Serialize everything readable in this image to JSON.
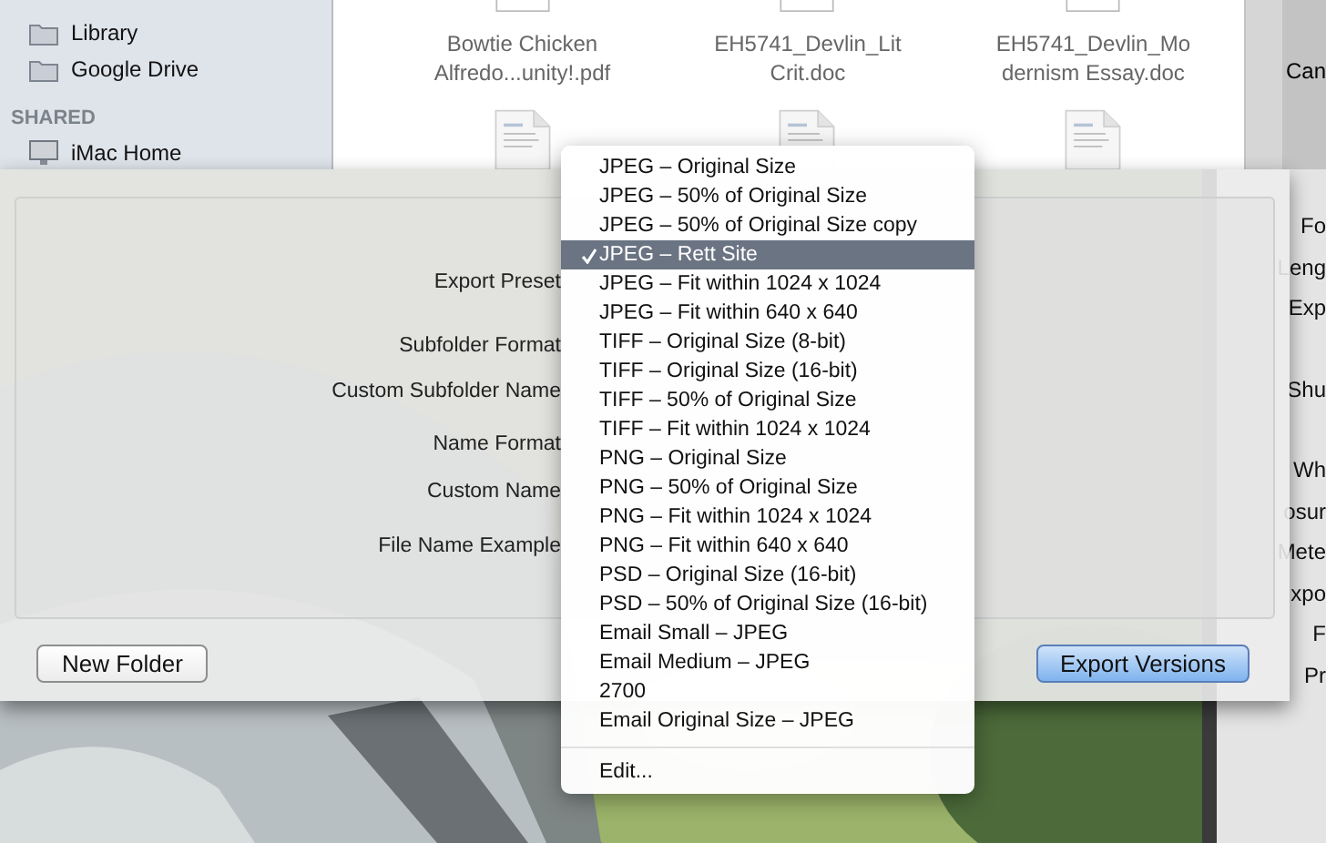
{
  "sidebar": {
    "items": [
      {
        "label": "Library",
        "kind": "folder"
      },
      {
        "label": "Google Drive",
        "kind": "folder"
      }
    ],
    "sections": [
      {
        "heading": "SHARED",
        "items": [
          {
            "label": "iMac Home",
            "kind": "computer"
          }
        ]
      }
    ]
  },
  "files": [
    {
      "name_lines": [
        "Bowtie Chicken",
        "Alfredo...unity!.pdf"
      ]
    },
    {
      "name_lines": [
        "EH5741_Devlin_Lit",
        "Crit.doc"
      ]
    },
    {
      "name_lines": [
        "EH5741_Devlin_Mo",
        "dernism Essay.doc"
      ]
    }
  ],
  "top_right_label": "Can",
  "right_panel": {
    "labels": [
      "Fo",
      "Leng",
      "Exp",
      "Shu",
      "Wh",
      "osur",
      "Mete",
      "xpo",
      "F",
      "Pr"
    ]
  },
  "dialog": {
    "labels": [
      "Export Preset",
      "Subfolder Format",
      "Custom Subfolder Name",
      "Name Format",
      "Custom Name",
      "File Name Example"
    ],
    "new_folder_button": "New Folder",
    "export_button": "Export Versions"
  },
  "menu": {
    "items": [
      {
        "label": "JPEG – Original Size",
        "selected": false
      },
      {
        "label": "JPEG – 50% of Original Size",
        "selected": false
      },
      {
        "label": "JPEG – 50% of Original Size copy",
        "selected": false
      },
      {
        "label": "JPEG – Rett Site",
        "selected": true
      },
      {
        "label": "JPEG – Fit within 1024 x 1024",
        "selected": false
      },
      {
        "label": "JPEG – Fit within 640 x 640",
        "selected": false
      },
      {
        "label": "TIFF – Original Size (8-bit)",
        "selected": false
      },
      {
        "label": "TIFF – Original Size (16-bit)",
        "selected": false
      },
      {
        "label": "TIFF – 50% of Original Size",
        "selected": false
      },
      {
        "label": "TIFF – Fit within 1024 x 1024",
        "selected": false
      },
      {
        "label": "PNG – Original Size",
        "selected": false
      },
      {
        "label": "PNG – 50% of Original Size",
        "selected": false
      },
      {
        "label": "PNG – Fit within 1024 x 1024",
        "selected": false
      },
      {
        "label": "PNG – Fit within 640 x 640",
        "selected": false
      },
      {
        "label": "PSD – Original Size (16-bit)",
        "selected": false
      },
      {
        "label": "PSD – 50% of Original Size (16-bit)",
        "selected": false
      },
      {
        "label": "Email Small – JPEG",
        "selected": false
      },
      {
        "label": "Email Medium – JPEG",
        "selected": false
      },
      {
        "label": "2700",
        "selected": false
      },
      {
        "label": "Email Original Size – JPEG",
        "selected": false
      }
    ],
    "edit_item": "Edit..."
  }
}
